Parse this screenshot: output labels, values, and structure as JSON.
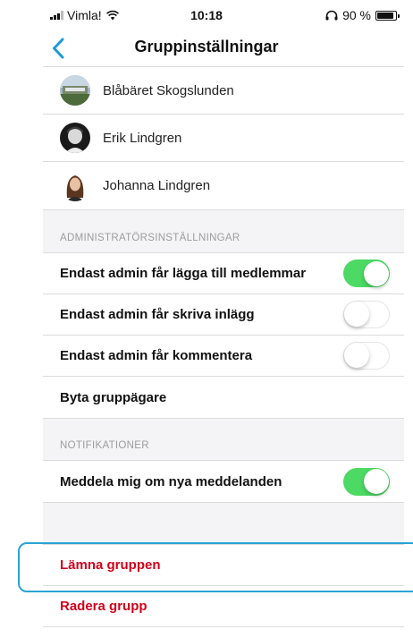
{
  "status_bar": {
    "carrier": "Vimla!",
    "time": "10:18",
    "battery": "90 %",
    "battery_level": 0.9
  },
  "nav": {
    "title": "Gruppinställningar"
  },
  "members": [
    {
      "name": "Blåbäret Skogslunden"
    },
    {
      "name": "Erik Lindgren"
    },
    {
      "name": "Johanna Lindgren"
    }
  ],
  "admin_section": {
    "header": "ADMINISTRATÖRSINSTÄLLNINGAR",
    "items": [
      {
        "label": "Endast admin får lägga till medlemmar",
        "toggle": true
      },
      {
        "label": "Endast admin får skriva inlägg",
        "toggle": false
      },
      {
        "label": "Endast admin får kommentera",
        "toggle": false
      },
      {
        "label": "Byta gruppägare"
      }
    ]
  },
  "notifications_section": {
    "header": "NOTIFIKATIONER",
    "items": [
      {
        "label": "Meddela mig om nya meddelanden",
        "toggle": true
      }
    ]
  },
  "actions": {
    "leave_group": "Lämna gruppen",
    "delete_group": "Radera grupp"
  },
  "colors": {
    "accent": "#1a9bd7",
    "toggle_on": "#4cd964",
    "destructive": "#d0021b",
    "highlight": "#2aa3d6"
  }
}
